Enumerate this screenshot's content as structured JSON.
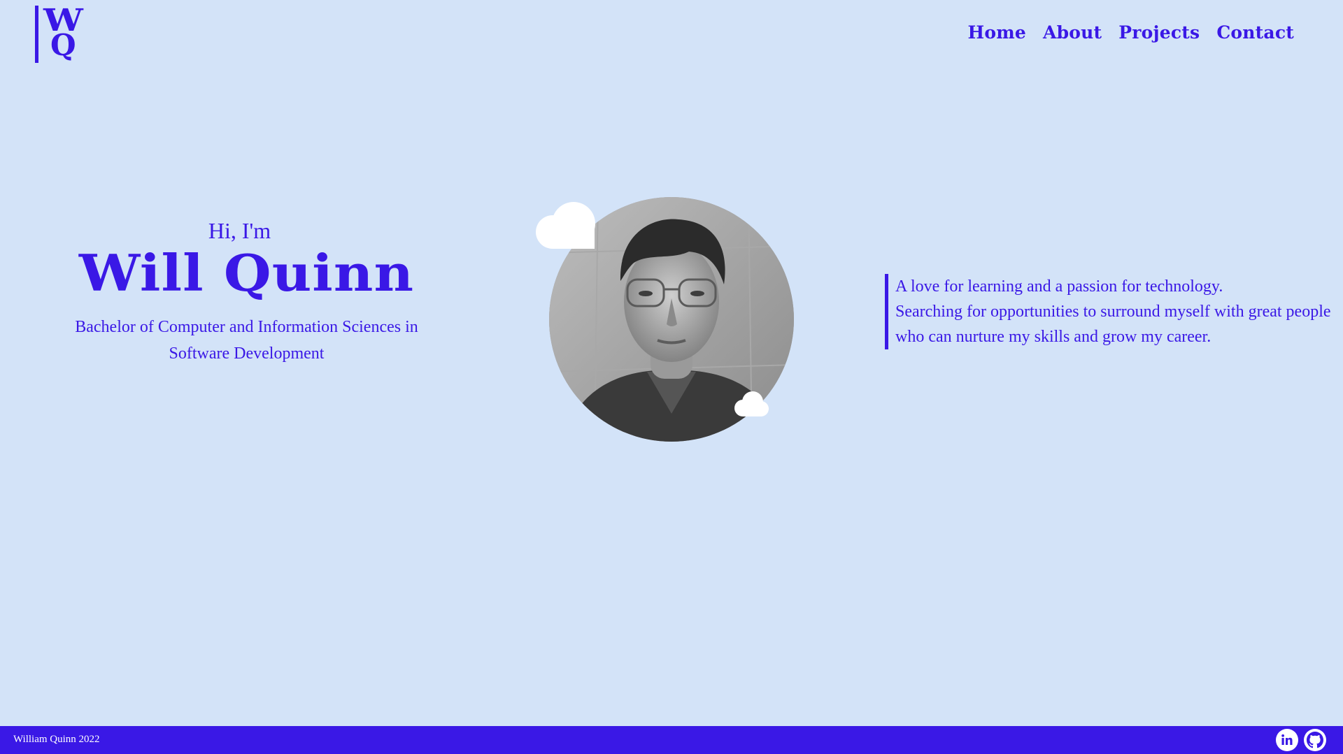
{
  "header": {
    "logo": {
      "top_letter": "W",
      "bottom_letter": "Q"
    },
    "nav": [
      {
        "label": "Home"
      },
      {
        "label": "About"
      },
      {
        "label": "Projects"
      },
      {
        "label": "Contact"
      }
    ]
  },
  "hero": {
    "greeting": "Hi, I'm",
    "name": "Will Quinn",
    "degree": "Bachelor of Computer and Information Sciences in Software Development"
  },
  "portrait": {
    "icon": "profile-photo"
  },
  "tagline": {
    "lines": [
      "A love for learning and a passion for technology.",
      "Searching for opportunities to surround myself with great people",
      "who can nurture my skills and grow my career."
    ]
  },
  "footer": {
    "copyright": "William Quinn 2022",
    "social": [
      {
        "icon": "linkedin-icon"
      },
      {
        "icon": "github-icon"
      }
    ]
  },
  "colors": {
    "background": "#d3e3f8",
    "accent": "#3a18e6",
    "cloud": "#ffffff"
  }
}
